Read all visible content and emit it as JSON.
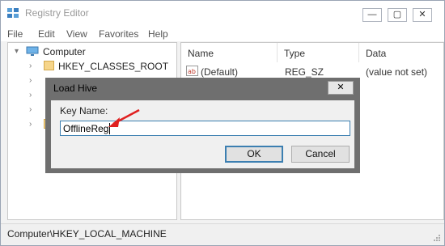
{
  "window": {
    "title": "Registry Editor",
    "controls": [
      "—",
      "▢",
      "✕"
    ]
  },
  "menu": [
    "File",
    "Edit",
    "View",
    "Favorites",
    "Help"
  ],
  "tree": {
    "root": "Computer",
    "first_child": "HKEY_CLASSES_ROOT"
  },
  "list": {
    "headers": [
      "Name",
      "Type",
      "Data"
    ],
    "rows": [
      {
        "name": "(Default)",
        "type": "REG_SZ",
        "data": "(value not set)"
      }
    ]
  },
  "status": "Computer\\HKEY_LOCAL_MACHINE",
  "dialog": {
    "title": "Load Hive",
    "label": "Key Name:",
    "value": "OfflineReg",
    "ok": "OK",
    "cancel": "Cancel",
    "close": "✕"
  },
  "annotation_color": "#e02020"
}
